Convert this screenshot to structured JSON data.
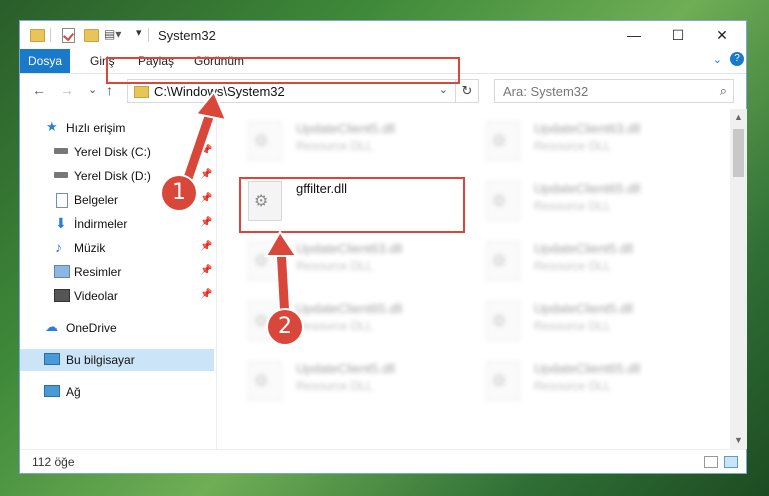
{
  "title": "System32",
  "window_buttons": {
    "minimize": "—",
    "maximize": "☐",
    "close": "✕"
  },
  "ribbon": {
    "tabs": [
      "Dosya",
      "Giriş",
      "Paylaş",
      "Görünüm"
    ],
    "help": "?",
    "expand": "⌄"
  },
  "address": {
    "path": "C:\\Windows\\System32",
    "refresh": "↻",
    "dropdown": "⌄"
  },
  "search": {
    "placeholder": "Ara: System32",
    "icon": "search-icon"
  },
  "nav": {
    "back": "←",
    "forward": "→",
    "recent": "⌄",
    "up": "↑"
  },
  "sidebar": {
    "items": [
      {
        "label": "Hızlı erişim",
        "pinned": false
      },
      {
        "label": "Yerel Disk (C:)",
        "pinned": true
      },
      {
        "label": "Yerel Disk (D:)",
        "pinned": true
      },
      {
        "label": "Belgeler",
        "pinned": true
      },
      {
        "label": "İndirmeler",
        "pinned": true
      },
      {
        "label": "Müzik",
        "pinned": true
      },
      {
        "label": "Resimler",
        "pinned": true
      },
      {
        "label": "Videolar",
        "pinned": true
      },
      {
        "label": "OneDrive",
        "pinned": false
      },
      {
        "label": "Bu bilgisayar",
        "pinned": false,
        "selected": true
      },
      {
        "label": "Ağ",
        "pinned": false
      }
    ]
  },
  "files": {
    "col1": [
      {
        "name": "UpdateClient5.dll",
        "type": "Resource DLL"
      },
      {
        "name": "gffilter.dll",
        "type": ""
      },
      {
        "name": "UpdateClient63.dll",
        "type": "Resource DLL"
      },
      {
        "name": "UpdateClient65.dll",
        "type": "Resource DLL"
      },
      {
        "name": "UpdateClient5.dll",
        "type": "Resource DLL"
      }
    ],
    "col2": [
      {
        "name": "UpdateClient63.dll",
        "type": "Resource DLL"
      },
      {
        "name": "UpdateClient65.dll",
        "type": "Resource DLL"
      },
      {
        "name": "UpdateClient5.dll",
        "type": "Resource DLL"
      },
      {
        "name": "UpdateClient5.dll",
        "type": "Resource DLL"
      },
      {
        "name": "UpdateClient65.dll",
        "type": "Resource DLL"
      }
    ]
  },
  "status": {
    "count": "112 öğe"
  },
  "annotations": {
    "step1": "1",
    "step2": "2",
    "color": "#d9463a"
  }
}
